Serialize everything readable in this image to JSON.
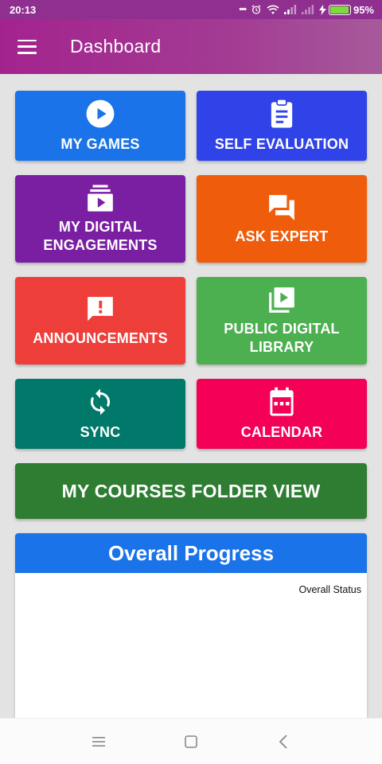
{
  "status_bar": {
    "time": "20:13",
    "dots": "•••",
    "battery_percent": "95%",
    "battery_level": 0.95
  },
  "app_bar": {
    "title": "Dashboard"
  },
  "tiles": [
    {
      "label": "MY GAMES",
      "icon": "play-circle-icon",
      "color": "#1a73e8"
    },
    {
      "label": "SELF EVALUATION",
      "icon": "clipboard-icon",
      "color": "#2f43e8"
    },
    {
      "label": "MY DIGITAL ENGAGEMENTS",
      "icon": "video-library-icon",
      "color": "#7b1fa2"
    },
    {
      "label": "ASK EXPERT",
      "icon": "chat-bubbles-icon",
      "color": "#ef5d0c"
    },
    {
      "label": "ANNOUNCEMENTS",
      "icon": "feedback-icon",
      "color": "#ee3e3a"
    },
    {
      "label": "PUBLIC DIGITAL LIBRARY",
      "icon": "slideshow-icon",
      "color": "#4caf50"
    },
    {
      "label": "SYNC",
      "icon": "sync-icon",
      "color": "#00796b"
    },
    {
      "label": "CALENDAR",
      "icon": "calendar-icon",
      "color": "#f50057"
    }
  ],
  "courses_button": {
    "label": "MY COURSES FOLDER VIEW",
    "color": "#2e7d32"
  },
  "progress": {
    "title": "Overall Progress",
    "status_label": "Overall Status",
    "header_color": "#1a73e8"
  }
}
